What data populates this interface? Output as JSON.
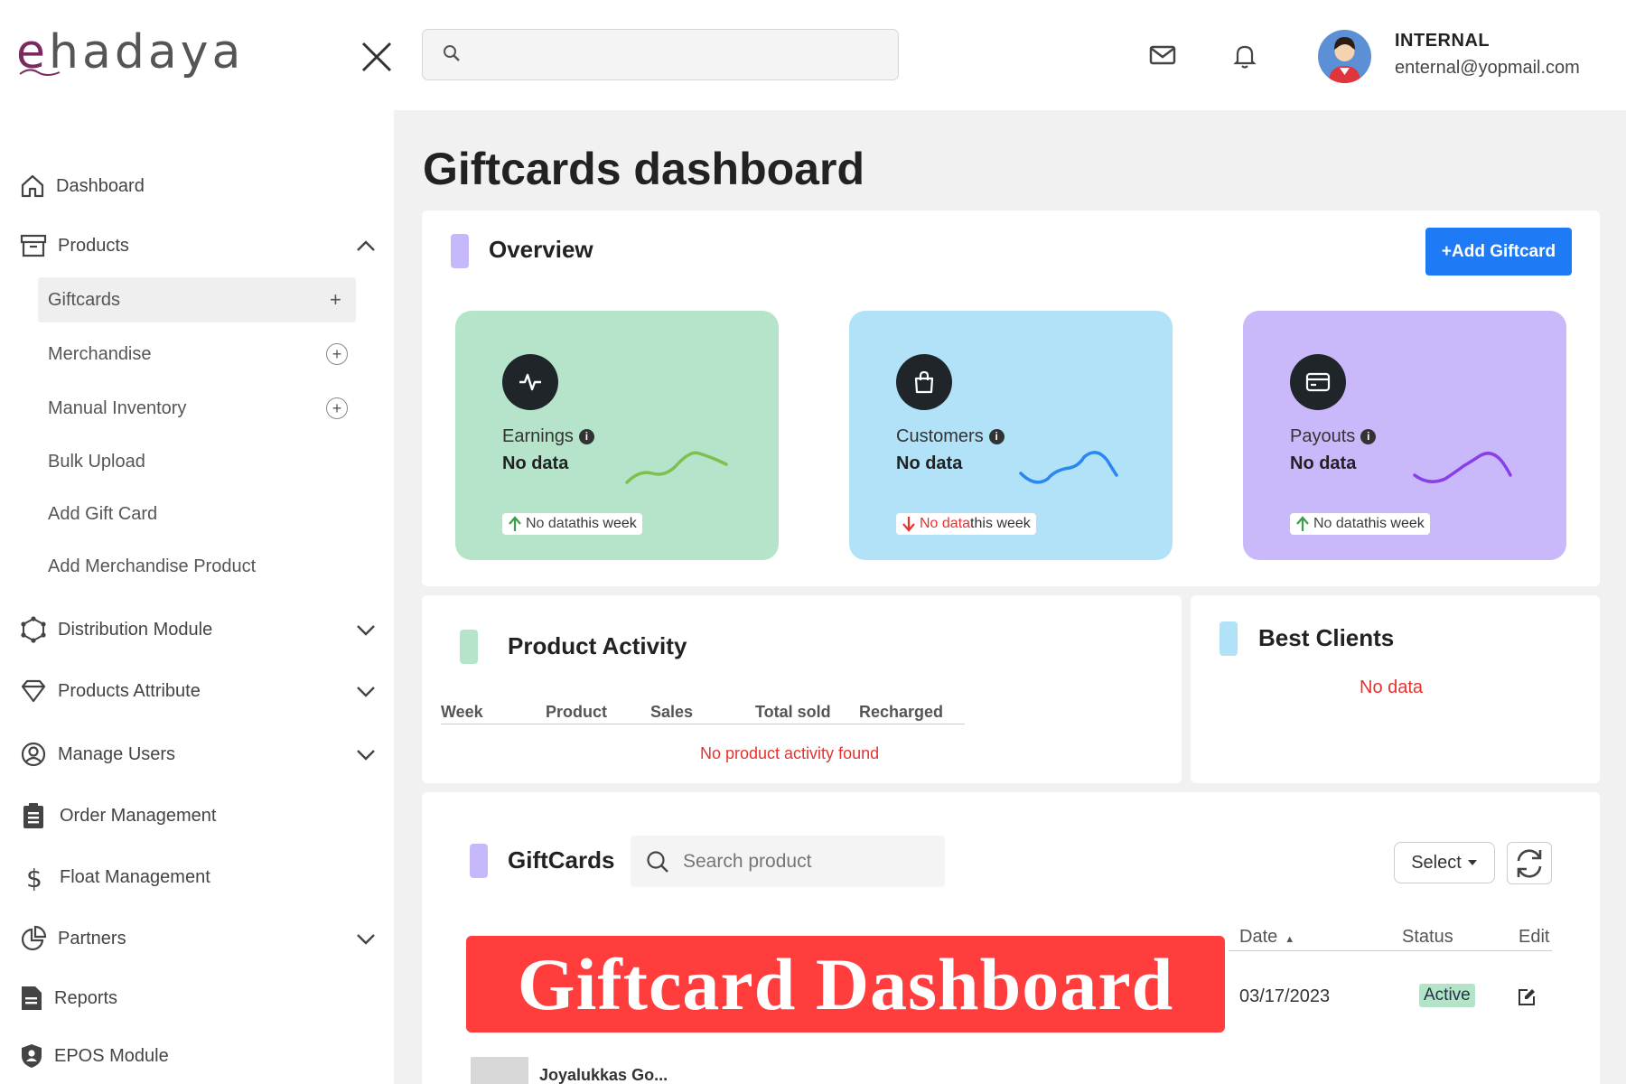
{
  "header": {
    "logo_text": "ehadaya",
    "search_placeholder": "",
    "user_name": "INTERNAL",
    "user_email": "enternal@yopmail.com"
  },
  "sidebar": {
    "items": [
      {
        "label": "Dashboard",
        "icon": "home-icon"
      },
      {
        "label": "Products",
        "icon": "archive-icon",
        "expanded": true,
        "children": [
          {
            "label": "Giftcards",
            "active": true
          },
          {
            "label": "Merchandise"
          },
          {
            "label": "Manual Inventory"
          },
          {
            "label": "Bulk Upload"
          },
          {
            "label": "Add Gift Card"
          },
          {
            "label": "Add Merchandise Product"
          }
        ]
      },
      {
        "label": "Distribution Module",
        "icon": "network-icon"
      },
      {
        "label": "Products Attribute",
        "icon": "diamond-icon"
      },
      {
        "label": "Manage Users",
        "icon": "user-circle-icon"
      },
      {
        "label": "Order Management",
        "icon": "clipboard-icon"
      },
      {
        "label": "Float Management",
        "icon": "dollar-icon"
      },
      {
        "label": "Partners",
        "icon": "pie-chart-icon"
      },
      {
        "label": "Reports",
        "icon": "report-icon"
      },
      {
        "label": "EPOS Module",
        "icon": "shield-user-icon"
      }
    ]
  },
  "page": {
    "title": "Giftcards dashboard"
  },
  "overview": {
    "title": "Overview",
    "add_button": "+Add Giftcard",
    "stats": [
      {
        "label": "Earnings",
        "value": "No data",
        "trend_word": "No data",
        "trend_rest": " this week",
        "trend": "up",
        "bg": "#b5e4cb",
        "spark": "#7fbf4d"
      },
      {
        "label": "Customers",
        "value": "No data",
        "trend_word": "No data",
        "trend_rest": " this week",
        "trend": "down",
        "bg": "#b1e2f8",
        "spark": "#2a86f0"
      },
      {
        "label": "Payouts",
        "value": "No data",
        "trend_word": "No data",
        "trend_rest": " this week",
        "trend": "up",
        "bg": "#c9b9fa",
        "spark": "#8a3fe6"
      }
    ]
  },
  "product_activity": {
    "title": "Product Activity",
    "columns": [
      "Week",
      "Product",
      "Sales",
      "Total sold",
      "Recharged"
    ],
    "empty": "No product activity found"
  },
  "best_clients": {
    "title": "Best Clients",
    "empty": "No data"
  },
  "giftcards": {
    "title": "GiftCards",
    "search_placeholder": "Search product",
    "select_label": "Select",
    "columns": {
      "date": "Date",
      "status": "Status",
      "edit": "Edit"
    },
    "rows": [
      {
        "date": "03/17/2023",
        "status": "Active"
      },
      {
        "name": "Joyalukkas Go..."
      }
    ]
  },
  "banner": "Giftcard Dashboard"
}
